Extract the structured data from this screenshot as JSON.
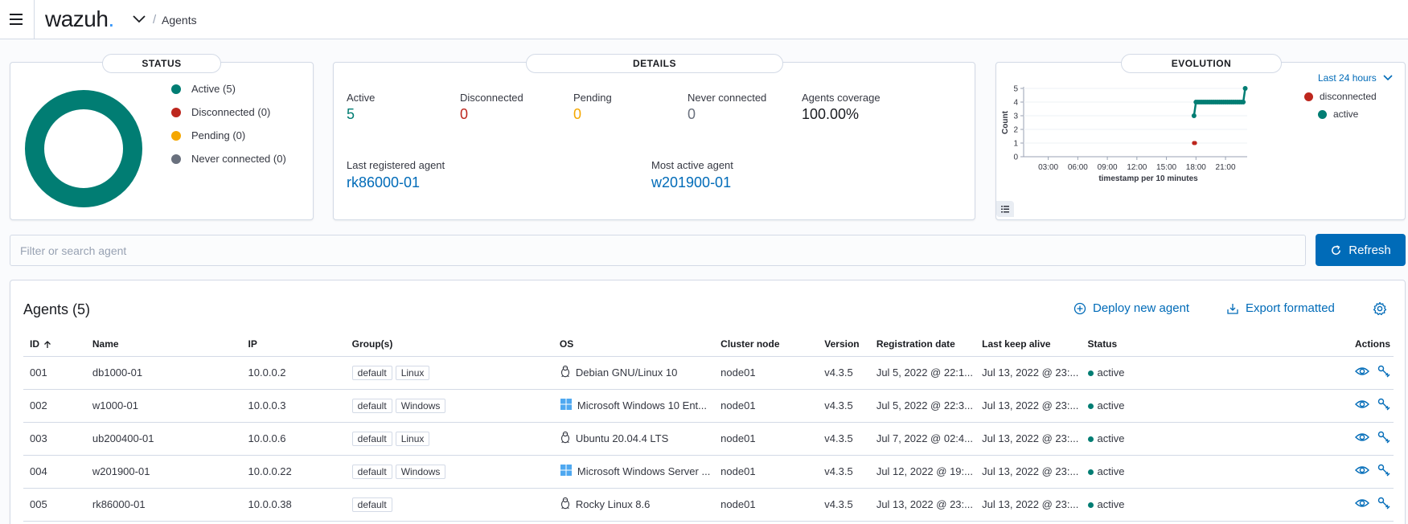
{
  "header": {
    "logo_text": "wazuh",
    "logo_dot": ".",
    "breadcrumb": "Agents",
    "separator": "/"
  },
  "status": {
    "title": "STATUS",
    "legend": [
      {
        "label": "Active (5)",
        "color": "#017d73"
      },
      {
        "label": "Disconnected (0)",
        "color": "#bd271e"
      },
      {
        "label": "Pending (0)",
        "color": "#f5a700"
      },
      {
        "label": "Never connected (0)",
        "color": "#69707d"
      }
    ],
    "donut_color": "#017d73"
  },
  "details": {
    "title": "DETAILS",
    "stats": [
      {
        "label": "Active",
        "value": "5",
        "color": "#017d73"
      },
      {
        "label": "Disconnected",
        "value": "0",
        "color": "#bd271e"
      },
      {
        "label": "Pending",
        "value": "0",
        "color": "#f5a700"
      },
      {
        "label": "Never connected",
        "value": "0",
        "color": "#69707d"
      },
      {
        "label": "Agents coverage",
        "value": "100.00%",
        "color": "#1a1c21"
      }
    ],
    "last_registered_label": "Last registered agent",
    "last_registered_value": "rk86000-01",
    "most_active_label": "Most active agent",
    "most_active_value": "w201900-01"
  },
  "evolution": {
    "title": "EVOLUTION",
    "time_range": "Last 24 hours",
    "legend": [
      {
        "label": "disconnected",
        "color": "#bd271e"
      },
      {
        "label": "active",
        "color": "#017d73"
      }
    ]
  },
  "chart_data": {
    "type": "line",
    "xlabel": "timestamp per 10 minutes",
    "ylabel": "Count",
    "ylim": [
      0,
      5
    ],
    "y_ticks": [
      "0",
      "1",
      "2",
      "3",
      "4",
      "5"
    ],
    "x_ticks": [
      "03:00",
      "06:00",
      "09:00",
      "12:00",
      "15:00",
      "18:00",
      "21:00"
    ],
    "x_tick_hours": [
      3,
      6,
      9,
      12,
      15,
      18,
      21
    ],
    "xlim_hours": [
      0.5,
      23.2
    ],
    "series": [
      {
        "name": "active",
        "color": "#017d73",
        "x": [
          17.8,
          18.0,
          18.2,
          18.4,
          18.6,
          18.8,
          19.0,
          19.2,
          19.4,
          19.6,
          19.8,
          20.0,
          20.2,
          20.4,
          20.6,
          20.8,
          21.0,
          21.2,
          21.4,
          21.6,
          21.8,
          22.0,
          22.2,
          22.4,
          22.6,
          22.8,
          23.0
        ],
        "values": [
          3,
          4,
          4,
          4,
          4,
          4,
          4,
          4,
          4,
          4,
          4,
          4,
          4,
          4,
          4,
          4,
          4,
          4,
          4,
          4,
          4,
          4,
          4,
          4,
          4,
          4,
          5
        ]
      },
      {
        "name": "disconnected",
        "color": "#bd271e",
        "x": [
          17.8,
          17.9
        ],
        "values": [
          1,
          1
        ]
      }
    ],
    "grid": true
  },
  "search": {
    "placeholder": "Filter or search agent"
  },
  "refresh_label": "Refresh",
  "agents": {
    "title": "Agents (5)",
    "deploy_label": "Deploy new agent",
    "export_label": "Export formatted",
    "columns": [
      "ID",
      "Name",
      "IP",
      "Group(s)",
      "OS",
      "Cluster node",
      "Version",
      "Registration date",
      "Last keep alive",
      "Status",
      "Actions"
    ],
    "rows": [
      {
        "id": "001",
        "name": "db1000-01",
        "ip": "10.0.0.2",
        "groups": [
          "default",
          "Linux"
        ],
        "os": "Debian GNU/Linux 10",
        "os_icon": "linux-icon",
        "node": "node01",
        "version": "v4.3.5",
        "registration": "Jul 5, 2022 @ 22:1...",
        "keepalive": "Jul 13, 2022 @ 23:...",
        "status": "active"
      },
      {
        "id": "002",
        "name": "w1000-01",
        "ip": "10.0.0.3",
        "groups": [
          "default",
          "Windows"
        ],
        "os": "Microsoft Windows 10 Ent...",
        "os_icon": "windows-icon",
        "node": "node01",
        "version": "v4.3.5",
        "registration": "Jul 5, 2022 @ 22:3...",
        "keepalive": "Jul 13, 2022 @ 23:...",
        "status": "active"
      },
      {
        "id": "003",
        "name": "ub200400-01",
        "ip": "10.0.0.6",
        "groups": [
          "default",
          "Linux"
        ],
        "os": "Ubuntu 20.04.4 LTS",
        "os_icon": "linux-icon",
        "node": "node01",
        "version": "v4.3.5",
        "registration": "Jul 7, 2022 @ 02:4...",
        "keepalive": "Jul 13, 2022 @ 23:...",
        "status": "active"
      },
      {
        "id": "004",
        "name": "w201900-01",
        "ip": "10.0.0.22",
        "groups": [
          "default",
          "Windows"
        ],
        "os": "Microsoft Windows Server ...",
        "os_icon": "windows-icon",
        "node": "node01",
        "version": "v4.3.5",
        "registration": "Jul 12, 2022 @ 19:...",
        "keepalive": "Jul 13, 2022 @ 23:...",
        "status": "active"
      },
      {
        "id": "005",
        "name": "rk86000-01",
        "ip": "10.0.0.38",
        "groups": [
          "default"
        ],
        "os": "Rocky Linux 8.6",
        "os_icon": "linux-icon",
        "node": "node01",
        "version": "v4.3.5",
        "registration": "Jul 13, 2022 @ 23:...",
        "keepalive": "Jul 13, 2022 @ 23:...",
        "status": "active"
      }
    ]
  }
}
